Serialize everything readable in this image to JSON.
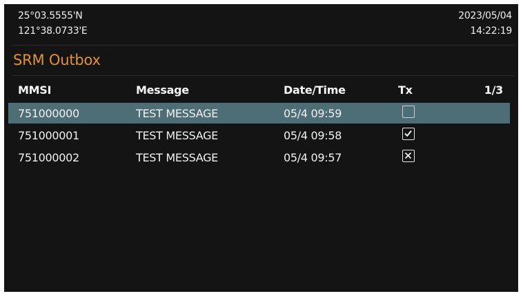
{
  "status": {
    "latitude": "25°03.5555'N",
    "longitude": "121°38.0733'E",
    "date": "2023/05/04",
    "time": "14:22:19"
  },
  "page": {
    "title": "SRM Outbox"
  },
  "table": {
    "columns": {
      "mmsi": "MMSI",
      "message": "Message",
      "datetime": "Date/Time",
      "tx": "Tx",
      "page_indicator": "1/3"
    },
    "rows": [
      {
        "mmsi": "751000000",
        "message": "TEST MESSAGE",
        "datetime": "05/4 09:59",
        "tx_status": "pending",
        "tx_icon": "empty-checkbox-icon",
        "selected": true
      },
      {
        "mmsi": "751000001",
        "message": "TEST MESSAGE",
        "datetime": "05/4 09:58",
        "tx_status": "sent",
        "tx_icon": "checked-checkbox-icon",
        "selected": false
      },
      {
        "mmsi": "751000002",
        "message": "TEST MESSAGE",
        "datetime": "05/4 09:57",
        "tx_status": "failed",
        "tx_icon": "failed-checkbox-icon",
        "selected": false
      }
    ]
  },
  "colors": {
    "background": "#141414",
    "title_accent": "#e0932f",
    "selection": "#4d6e76",
    "text": "#f2f2f2"
  }
}
